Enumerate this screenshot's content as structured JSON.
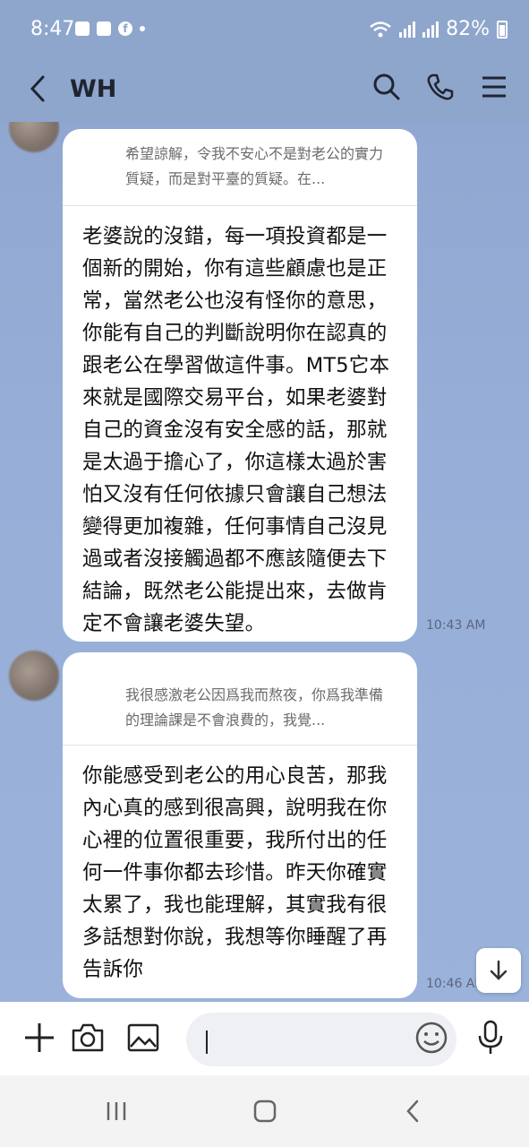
{
  "status": {
    "time": "8:47",
    "battery": "82%"
  },
  "header": {
    "title": "WH"
  },
  "messages": [
    {
      "reply_preview": "希望諒解，令我不安心不是對老公的實力質疑，而是對平臺的質疑。在...",
      "body": "老婆說的沒錯，每一項投資都是一個新的開始，你有這些顧慮也是正常，當然老公也沒有怪你的意思，你能有自己的判斷說明你在認真的跟老公在學習做這件事。MT5它本來就是國際交易平台，如果老婆對自己的資金沒有安全感的話，那就是太過于擔心了，你這樣太過於害怕又沒有任何依據只會讓自己想法變得更加複雜，任何事情自己沒見過或者沒接觸過都不應該隨便去下結論，既然老公能提出來，去做肯定不會讓老婆失望。",
      "time": "10:43 AM"
    },
    {
      "reply_preview": "我很感激老公因爲我而熬夜，你爲我準備的理論課是不會浪費的，我覺...",
      "body": "你能感受到老公的用心良苦，那我內心真的感到很高興，說明我在你心裡的位置很重要，我所付出的任何一件事你都去珍惜。昨天你確實太累了，我也能理解，其實我有很多話想對你說，我想等你睡醒了再告訴你",
      "time": "10:46 AM"
    }
  ],
  "input": {
    "placeholder": ""
  },
  "icons": {
    "back": "chevron-left-icon",
    "search": "search-icon",
    "call": "phone-icon",
    "menu": "menu-icon",
    "add": "plus-icon",
    "camera": "camera-icon",
    "gallery": "image-icon",
    "emoji": "emoji-icon",
    "mic": "mic-icon",
    "scroll": "arrow-down-icon"
  }
}
